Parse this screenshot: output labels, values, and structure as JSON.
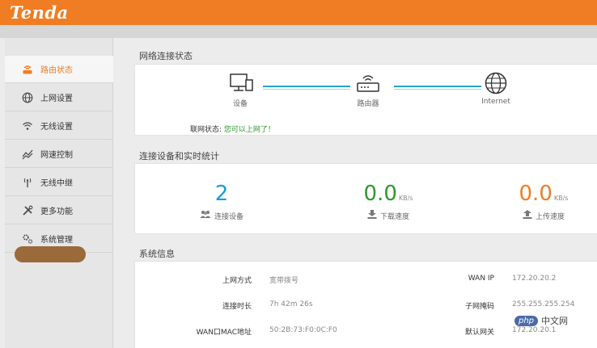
{
  "brand": {
    "logo_text": "Tenda"
  },
  "sidebar": {
    "items": [
      {
        "label": "路由状态",
        "icon": "router-icon",
        "active": true
      },
      {
        "label": "上网设置",
        "icon": "globe-icon"
      },
      {
        "label": "无线设置",
        "icon": "wifi-icon"
      },
      {
        "label": "网速控制",
        "icon": "speed-icon"
      },
      {
        "label": "无线中继",
        "icon": "repeater-icon"
      },
      {
        "label": "更多功能",
        "icon": "tools-icon"
      },
      {
        "label": "系统管理",
        "icon": "gear-icon"
      }
    ]
  },
  "network_status": {
    "title": "网络连接状态",
    "device_label": "设备",
    "router_label": "路由器",
    "internet_label": "Internet",
    "status_label": "联网状态:",
    "status_value": "您可以上网了！"
  },
  "stats": {
    "title": "连接设备和实时统计",
    "devices_count": "2",
    "devices_label": "连接设备",
    "download_value": "0.0",
    "download_unit": "KB/s",
    "download_label": "下载速度",
    "upload_value": "0.0",
    "upload_unit": "KB/s",
    "upload_label": "上传速度",
    "colors": {
      "devices": "#1a9bd7",
      "download": "#2a9a2a",
      "upload": "#f07d23"
    }
  },
  "system_info": {
    "title": "系统信息",
    "rows": [
      {
        "left_label": "上网方式",
        "left_value": "宽带拨号",
        "right_label": "WAN IP",
        "right_value": "172.20.20.2"
      },
      {
        "left_label": "连接时长",
        "left_value": "7h 42m 26s",
        "right_label": "子网掩码",
        "right_value": "255.255.255.254"
      },
      {
        "left_label": "WAN口MAC地址",
        "left_value": "50:2B:73:F0:0C:F0",
        "right_label": "默认网关",
        "right_value": "172.20.20.1"
      }
    ]
  },
  "watermark": {
    "badge": "php",
    "text": "中文网"
  }
}
